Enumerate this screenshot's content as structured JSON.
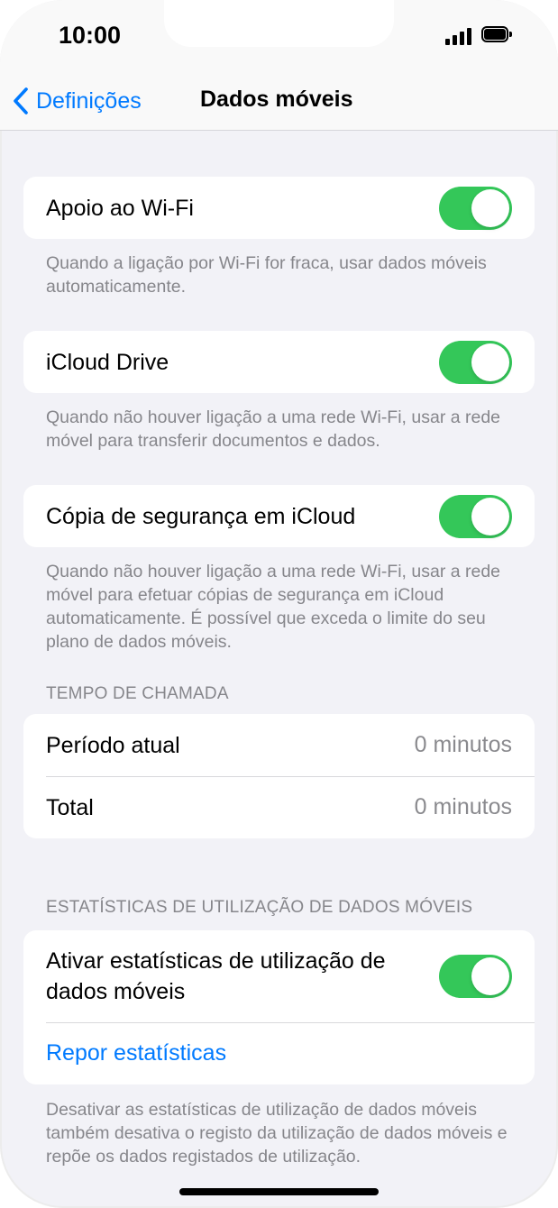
{
  "status": {
    "time": "10:00"
  },
  "nav": {
    "back_label": "Definições",
    "title": "Dados móveis"
  },
  "wifi_assist": {
    "label": "Apoio ao Wi-Fi",
    "enabled": true,
    "footer": "Quando a ligação por Wi-Fi for fraca, usar dados móveis automaticamente."
  },
  "icloud_drive": {
    "label": "iCloud Drive",
    "enabled": true,
    "footer": "Quando não houver ligação a uma rede Wi-Fi, usar a rede móvel para transferir documentos e dados."
  },
  "icloud_backup": {
    "label": "Cópia de segurança em iCloud",
    "enabled": true,
    "footer": "Quando não houver ligação a uma rede Wi-Fi, usar a rede móvel para efetuar cópias de segurança em iCloud automaticamente. É possível que exceda o limite do seu plano de dados móveis."
  },
  "call_time": {
    "header": "TEMPO DE CHAMADA",
    "current_period": {
      "label": "Período atual",
      "value": "0 minutos"
    },
    "total": {
      "label": "Total",
      "value": "0 minutos"
    }
  },
  "usage_stats": {
    "header": "ESTATÍSTICAS DE UTILIZAÇÃO DE DADOS MÓVEIS",
    "enable_label": "Ativar estatísticas de utilização de dados móveis",
    "enabled": true,
    "reset_label": "Repor estatísticas",
    "footer": "Desativar as estatísticas de utilização de dados móveis também desativa o registo da utilização de dados móveis e repõe os dados registados de utilização."
  },
  "colors": {
    "accent": "#007aff",
    "toggle_on": "#34c759",
    "background": "#f2f2f7",
    "secondary_text": "#86868b"
  }
}
